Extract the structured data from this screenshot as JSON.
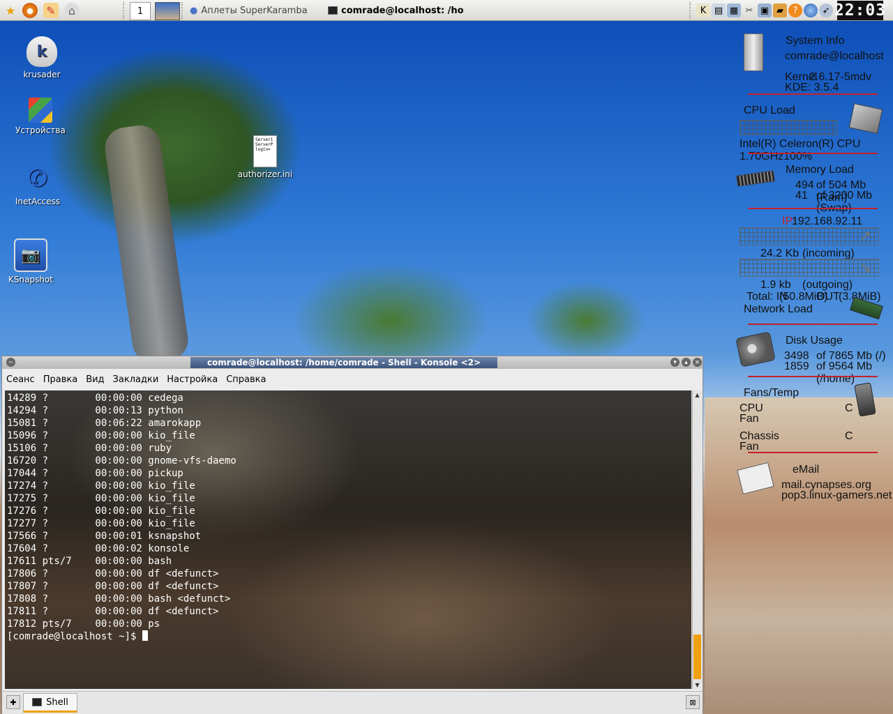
{
  "panel": {
    "pager_number": "1",
    "tasks": [
      {
        "label": "Аплеты SuperKaramba"
      },
      {
        "label": "comrade@localhost: /ho"
      }
    ],
    "clock": "22:03"
  },
  "desktop_icons": [
    {
      "label": "krusader"
    },
    {
      "label": "Устройства"
    },
    {
      "label": "InetAccess"
    },
    {
      "label": "KSnapshot"
    },
    {
      "label": "authorizer.ini"
    }
  ],
  "file_preview_text": "Server1\nServerP\nlogin=",
  "karamba": {
    "system_info": {
      "title": "System Info",
      "user": "comrade@localhost",
      "kernel_label": "Kernel",
      "kernel": "2.6.17-5mdv",
      "kde": "KDE: 3.5.4"
    },
    "cpu": {
      "title": "CPU Load",
      "name": "Intel(R) Celeron(R) CPU 1.70GHz100%"
    },
    "memory": {
      "title": "Memory Load",
      "ram_used": "494",
      "ram_total": "of 504 Mb (Ram)",
      "swap_used": "41",
      "swap_total": "of 3200 Mb (Swap)"
    },
    "network": {
      "title": "Network Load",
      "ip_label": "IP:",
      "ip": "192.168.92.11",
      "in_value": "24.2 Kb",
      "in_label": "(incoming)",
      "out_value": "1.9 kb",
      "out_label": "(outgoing)",
      "total_in_label": "Total: IN",
      "total_in": "(50.8MiB)",
      "total_out_label": "OUT",
      "total_out": "(3.8MiB)"
    },
    "disk": {
      "title": "Disk Usage",
      "root_used": "3498",
      "root_total": "of 7865 Mb (/)",
      "home_used": "1859",
      "home_total": "of 9564 Mb (/home)"
    },
    "fans": {
      "title": "Fans/Temp",
      "cpu_label": "CPU",
      "cpu_fan": "Fan",
      "cpu_unit": "C",
      "chassis_label": "Chassis",
      "chassis_fan": "Fan",
      "chassis_unit": "C"
    },
    "email": {
      "title": "eMail",
      "server1": "mail.cynapses.org",
      "server2": "pop3.linux-gamers.net"
    }
  },
  "konsole": {
    "title": "comrade@localhost: /home/comrade - Shell - Konsole <2>",
    "menu": [
      "Сеанс",
      "Правка",
      "Вид",
      "Закладки",
      "Настройка",
      "Справка"
    ],
    "lines": [
      "14289 ?        00:00:00 cedega",
      "14294 ?        00:00:13 python",
      "15081 ?        00:06:22 amarokapp",
      "15096 ?        00:00:00 kio_file",
      "15106 ?        00:00:00 ruby",
      "16720 ?        00:00:00 gnome-vfs-daemo",
      "17044 ?        00:00:00 pickup",
      "17274 ?        00:00:00 kio_file",
      "17275 ?        00:00:00 kio_file",
      "17276 ?        00:00:00 kio_file",
      "17277 ?        00:00:00 kio_file",
      "17566 ?        00:00:01 ksnapshot",
      "17604 ?        00:00:02 konsole",
      "17611 pts/7    00:00:00 bash",
      "17806 ?        00:00:00 df <defunct>",
      "17807 ?        00:00:00 df <defunct>",
      "17808 ?        00:00:00 bash <defunct>",
      "17811 ?        00:00:00 df <defunct>",
      "17812 pts/7    00:00:00 ps"
    ],
    "prompt": "[comrade@localhost ~]$ ",
    "tab_label": "Shell"
  }
}
